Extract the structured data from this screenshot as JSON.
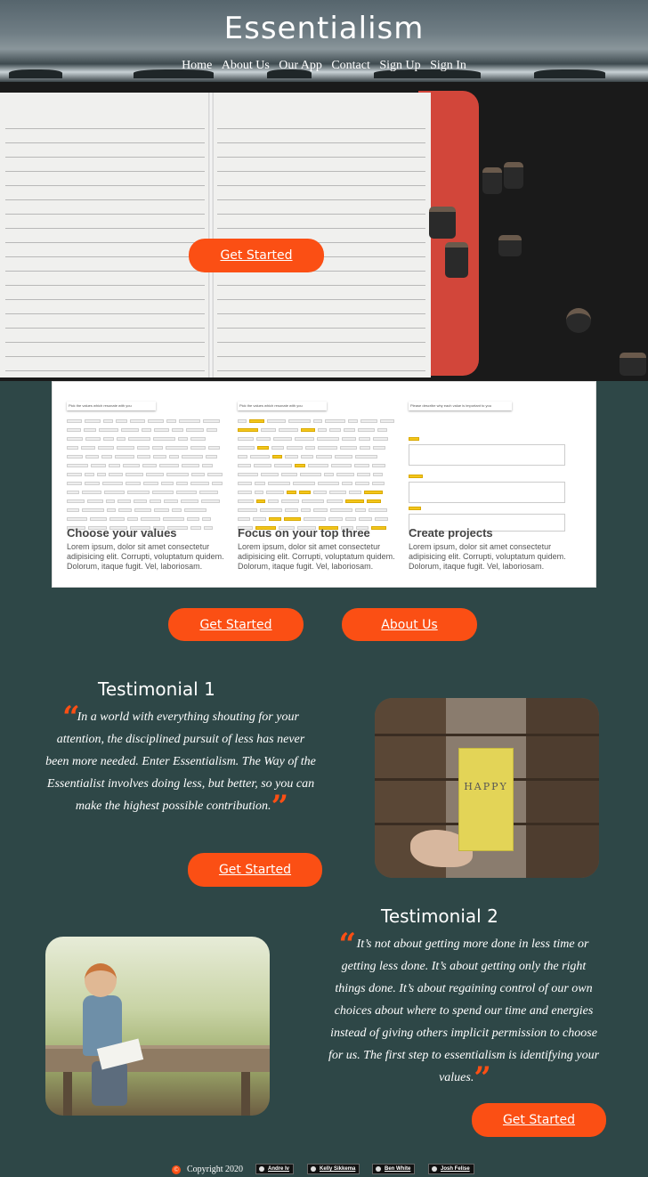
{
  "site": {
    "title": "Essentialism"
  },
  "nav": [
    {
      "label": "Home"
    },
    {
      "label": "About Us"
    },
    {
      "label": "Our App"
    },
    {
      "label": "Contact"
    },
    {
      "label": "Sign Up"
    },
    {
      "label": "Sign In"
    }
  ],
  "hero": {
    "cta_label": "Get Started"
  },
  "features": [
    {
      "title": "Choose your values",
      "body": "Lorem ipsum, dolor sit amet consectetur adipisicing elit. Corrupti, voluptatum quidem. Dolorum, itaque fugit. Vel, laboriosam.",
      "screenshot_caption": "Pick the values which resonate with you"
    },
    {
      "title": "Focus on your top three",
      "body": "Lorem ipsum, dolor sit amet consectetur adipisicing elit. Corrupti, voluptatum quidem. Dolorum, itaque fugit. Vel, laboriosam.",
      "screenshot_caption": "Pick the values which resonate with you"
    },
    {
      "title": "Create projects",
      "body": "Lorem ipsum, dolor sit amet consectetur adipisicing elit. Corrupti, voluptatum quidem. Dolorum, itaque fugit. Vel, laboriosam.",
      "screenshot_caption": "Please describe why each value is important to you"
    }
  ],
  "actions": {
    "get_started_label": "Get Started",
    "about_label": "About Us"
  },
  "testimonials": [
    {
      "title": "Testimonial 1",
      "quote": "In a world with everything shouting for your attention, the disciplined pursuit of less has never been more needed. Enter Essentialism. The Way of the Essentialist involves doing less, but better, so you can make the highest possible contribution.",
      "cta_label": "Get Started",
      "image_text": "HAPPY"
    },
    {
      "title": "Testimonial 2",
      "quote": "It’s not about getting more done in less time or getting less done. It’s about getting only the right things done. It’s about regaining control of our own choices about where to spend our time and energies instead of giving others implicit permission to choose for us. The first step to essentialism is identifying your values.",
      "cta_label": "Get Started"
    }
  ],
  "footer": {
    "copyright": "Copyright 2020",
    "authors": [
      "Andre Iv",
      "Kelly Sikkema",
      "Ben White",
      "Josh Felise"
    ]
  },
  "colors": {
    "background": "#2e4747",
    "accent": "#fb4f14",
    "text": "#ffffff"
  },
  "icons": [
    "open-quote-icon",
    "close-quote-icon",
    "copyright-icon",
    "github-icon"
  ]
}
